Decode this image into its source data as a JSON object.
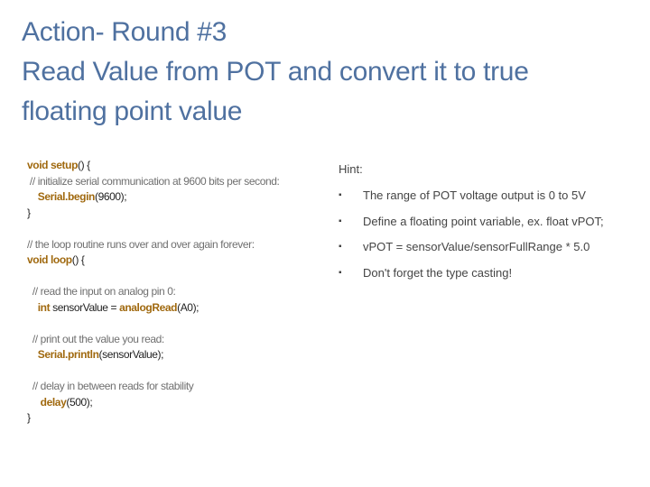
{
  "title": {
    "lines": [
      "Action- Round #3",
      "Read Value from POT and convert it to true",
      "floating point value"
    ]
  },
  "code": {
    "lines": [
      [
        {
          "t": "kw",
          "v": "void setup"
        },
        {
          "t": "tx",
          "v": "() {"
        }
      ],
      [
        {
          "t": "cm",
          "v": " // initialize serial communication at 9600 bits per second:"
        }
      ],
      [
        {
          "t": "tx",
          "v": "    "
        },
        {
          "t": "kw",
          "v": "Serial.begin"
        },
        {
          "t": "tx",
          "v": "(9600);"
        }
      ],
      [
        {
          "t": "tx",
          "v": "}"
        }
      ],
      [],
      [
        {
          "t": "cm",
          "v": "// the loop routine runs over and over again forever:"
        }
      ],
      [
        {
          "t": "kw",
          "v": "void loop"
        },
        {
          "t": "tx",
          "v": "() {"
        }
      ],
      [],
      [
        {
          "t": "cm",
          "v": "  // read the input on analog pin 0:"
        }
      ],
      [
        {
          "t": "tx",
          "v": "    "
        },
        {
          "t": "kw",
          "v": "int"
        },
        {
          "t": "tx",
          "v": " sensorValue = "
        },
        {
          "t": "kw",
          "v": "analogRead"
        },
        {
          "t": "tx",
          "v": "(A0);"
        }
      ],
      [],
      [
        {
          "t": "cm",
          "v": "  // print out the value you read:"
        }
      ],
      [
        {
          "t": "tx",
          "v": "    "
        },
        {
          "t": "kw",
          "v": "Serial.println"
        },
        {
          "t": "tx",
          "v": "(sensorValue);"
        }
      ],
      [],
      [
        {
          "t": "cm",
          "v": "  // delay in between reads for stability"
        }
      ],
      [
        {
          "t": "tx",
          "v": "     "
        },
        {
          "t": "kw",
          "v": "delay"
        },
        {
          "t": "tx",
          "v": "(500);"
        }
      ],
      [
        {
          "t": "tx",
          "v": "}"
        }
      ]
    ]
  },
  "hint": {
    "label": "Hint:",
    "bullet": "▪",
    "items": [
      "The range of POT voltage output is 0 to 5V",
      "Define a floating point variable, ex. float vPOT;",
      "vPOT = sensorValue/sensorFullRange  * 5.0",
      "Don't forget the type casting!"
    ]
  },
  "colors": {
    "title": "#4f71a0",
    "keyword": "#a0690f",
    "comment": "#6f6f6f",
    "text": "#222222"
  }
}
